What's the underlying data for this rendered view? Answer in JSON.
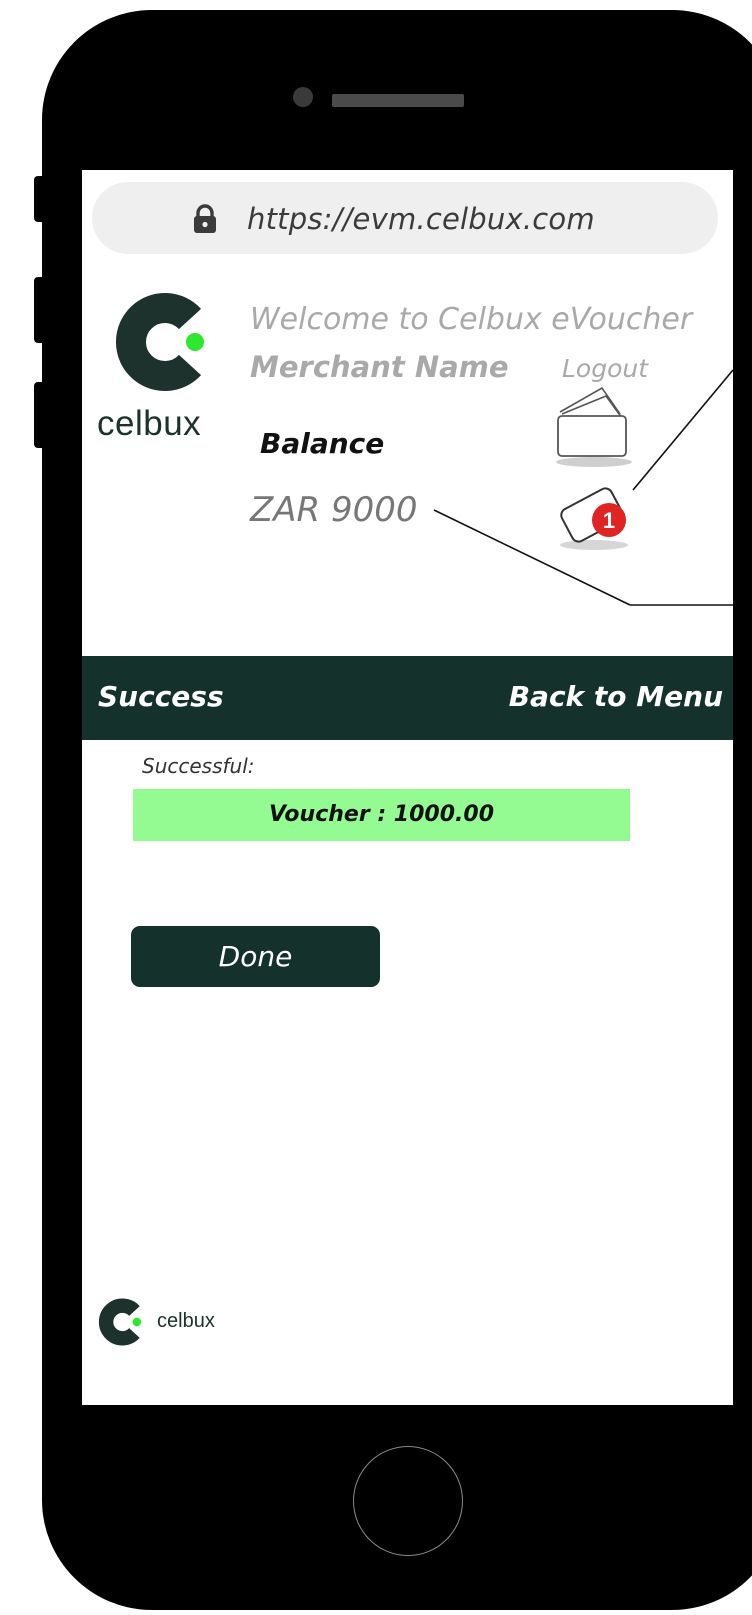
{
  "browser": {
    "url": "https://evm.celbux.com",
    "lock_icon": "lock-icon"
  },
  "header": {
    "brand": "celbux",
    "welcome": "Welcome to Celbux eVoucher",
    "merchant_name": "Merchant Name",
    "logout": "Logout",
    "balance_label": "Balance",
    "balance_value": "ZAR 9000",
    "notification_count": "1",
    "wallet_icon": "wallet-icon",
    "notification_icon": "voucher-notification-icon"
  },
  "nav": {
    "title": "Success",
    "back": "Back to Menu"
  },
  "result": {
    "label": "Successful:",
    "voucher": "Voucher : 1000.00"
  },
  "actions": {
    "done": "Done"
  },
  "footer": {
    "brand": "celbux"
  },
  "colors": {
    "brand_dark": "#15312c",
    "brand_green": "#2ee82e",
    "success_bg": "#93fb91",
    "badge_red": "#e02424"
  }
}
